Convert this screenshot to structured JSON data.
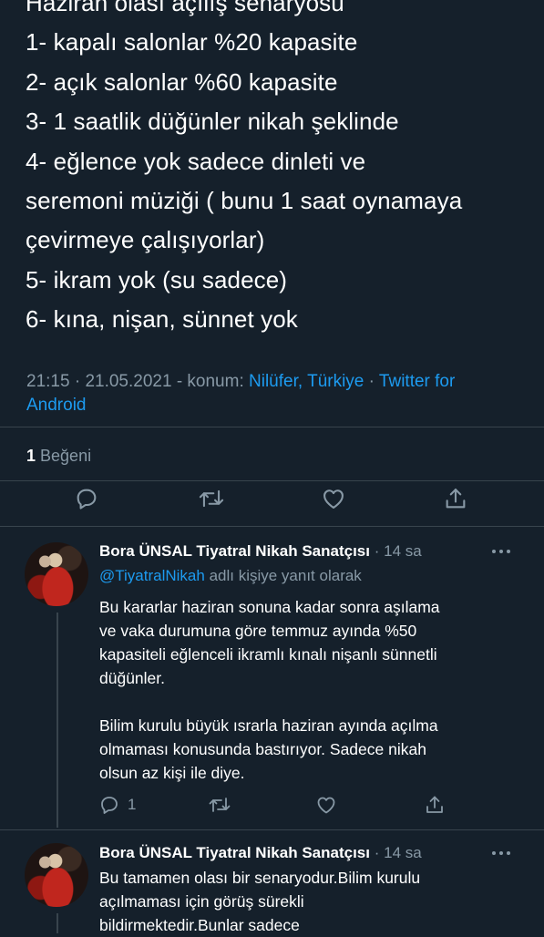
{
  "tweet": {
    "lines": [
      "Haziran olası açılış senaryosu",
      "1- kapalı salonlar %20 kapasite",
      "2- açık salonlar %60 kapasite",
      "3- 1 saatlik düğünler nikah şeklinde",
      "4- eğlence yok sadece dinleti ve",
      "seremoni müziği ( bunu 1 saat oynamaya",
      "çevirmeye çalışıyorlar)",
      "5- ikram yok (su sadece)",
      "6- kına, nişan, sünnet yok"
    ],
    "time": "21:15",
    "date": "21.05.2021",
    "location_prefix": "konum:",
    "location": "Nilüfer, Türkiye",
    "source": "Twitter for Android",
    "likes_count": "1",
    "likes_label": "Beğeni"
  },
  "replies": [
    {
      "name": "Bora ÜNSAL Tiyatral Nikah Sanatçısı",
      "time": "14 sa",
      "replying_handle": "@TiyatralNikah",
      "replying_suffix": "adlı kişiye yanıt olarak",
      "paragraph1": [
        "Bu kararlar haziran sonuna kadar sonra aşılama",
        "ve vaka durumuna göre temmuz ayında %50",
        "kapasiteli eğlenceli ikramlı kınalı nişanlı sünnetli",
        "düğünler."
      ],
      "paragraph2": [
        "Bilim kurulu büyük ısrarla haziran ayında açılma",
        "olmaması konusunda bastırıyor. Sadece nikah",
        "olsun az kişi ile diye."
      ],
      "reply_count": "1"
    },
    {
      "name": "Bora ÜNSAL Tiyatral Nikah Sanatçısı",
      "time": "14 sa",
      "lines": [
        "Bu tamamen olası bir senaryodur.Bilim kurulu",
        "açılmaması için görüş sürekli",
        "bildirmektedir.Bunlar sadece"
      ]
    }
  ],
  "colors": {
    "background": "#15202b",
    "text": "#ffffff",
    "secondary": "#8899a6",
    "link": "#1d9bf0",
    "divider": "#38444d"
  },
  "icons": {
    "reply": "reply-icon",
    "retweet": "retweet-icon",
    "like": "like-icon",
    "share": "share-icon",
    "more": "more-icon"
  }
}
